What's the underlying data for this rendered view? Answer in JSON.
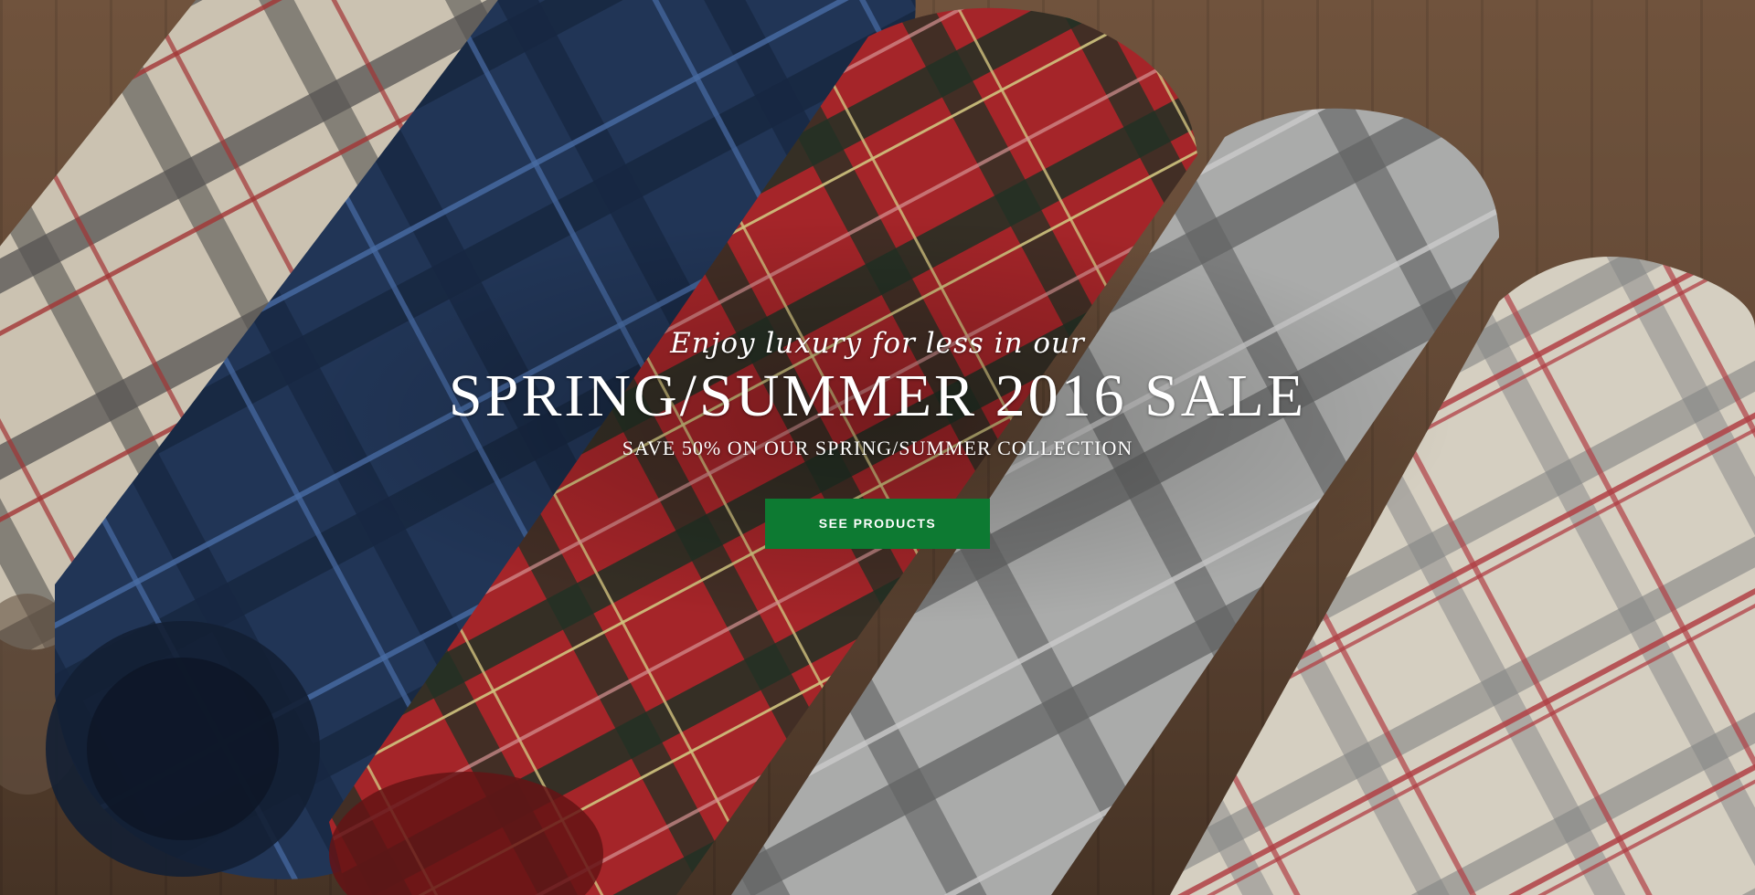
{
  "hero": {
    "kicker": "Enjoy luxury for less in our",
    "title": "SPRING/SUMMER 2016 SALE",
    "subtitle": "SAVE 50% ON OUR SPRING/SUMMER COLLECTION",
    "cta_label": "SEE PRODUCTS",
    "background_image": "plaid-scarves-photo"
  },
  "colors": {
    "cta_background": "#0d7a32",
    "text": "#ffffff"
  }
}
